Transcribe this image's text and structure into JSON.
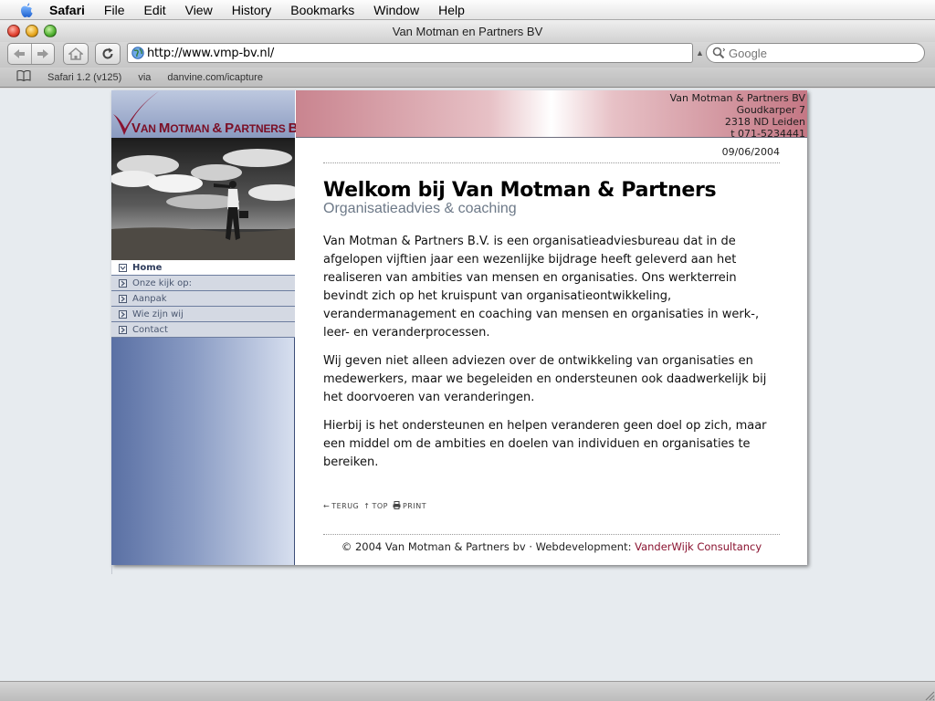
{
  "menubar": {
    "app": "Safari",
    "items": [
      "File",
      "Edit",
      "View",
      "History",
      "Bookmarks",
      "Window",
      "Help"
    ]
  },
  "window": {
    "title": "Van Motman en Partners BV"
  },
  "toolbar": {
    "url": "http://www.vmp-bv.nl/",
    "search_placeholder": "Google"
  },
  "bookmarks": {
    "items": [
      "Safari 1.2 (v125)",
      "via",
      "danvine.com/icapture"
    ]
  },
  "site": {
    "logo": "VAN MOTMAN & PARTNERS BV",
    "address": {
      "company": "Van Motman & Partners BV",
      "street": "Goudkarper 7",
      "city": "2318 ND Leiden",
      "phone": "t 071-5234441"
    },
    "nav": [
      {
        "label": "Home",
        "active": true
      },
      {
        "label": "Onze kijk op:",
        "active": false
      },
      {
        "label": "Aanpak",
        "active": false
      },
      {
        "label": "Wie zijn wij",
        "active": false
      },
      {
        "label": "Contact",
        "active": false
      }
    ],
    "date": "09/06/2004",
    "heading": "Welkom bij Van Motman & Partners",
    "subheading": "Organisatieadvies & coaching",
    "paragraphs": [
      "Van Motman & Partners B.V. is een organisatieadviesbureau dat in de afgelopen vijftien jaar een wezenlijke bijdrage heeft geleverd aan het realiseren van ambities van mensen en organisaties. Ons werkterrein bevindt zich op het kruispunt van organisatieontwikkeling, verandermanagement en coaching van mensen en organisaties in werk-, leer- en veranderprocessen.",
      "Wij geven niet alleen adviezen over de ontwikkeling van organisaties en medewerkers, maar we begeleiden en ondersteunen ook daadwerkelijk bij het doorvoeren van veranderingen.",
      "Hierbij is het ondersteunen en helpen veranderen geen doel op zich, maar een middel om de ambities en doelen van individuen en organisaties te bereiken."
    ],
    "tools": {
      "back": "TERUG",
      "top": "TOP",
      "print": "PRINT"
    },
    "footer": {
      "text": "© 2004 Van Motman & Partners bv · Webdevelopment: ",
      "link": "VanderWijk Consultancy"
    }
  },
  "colors": {
    "brand": "#7b0e25",
    "nav_bg": "#d4d9e3",
    "banner_pink": "#c9848f",
    "footer_link": "#8a1330"
  }
}
